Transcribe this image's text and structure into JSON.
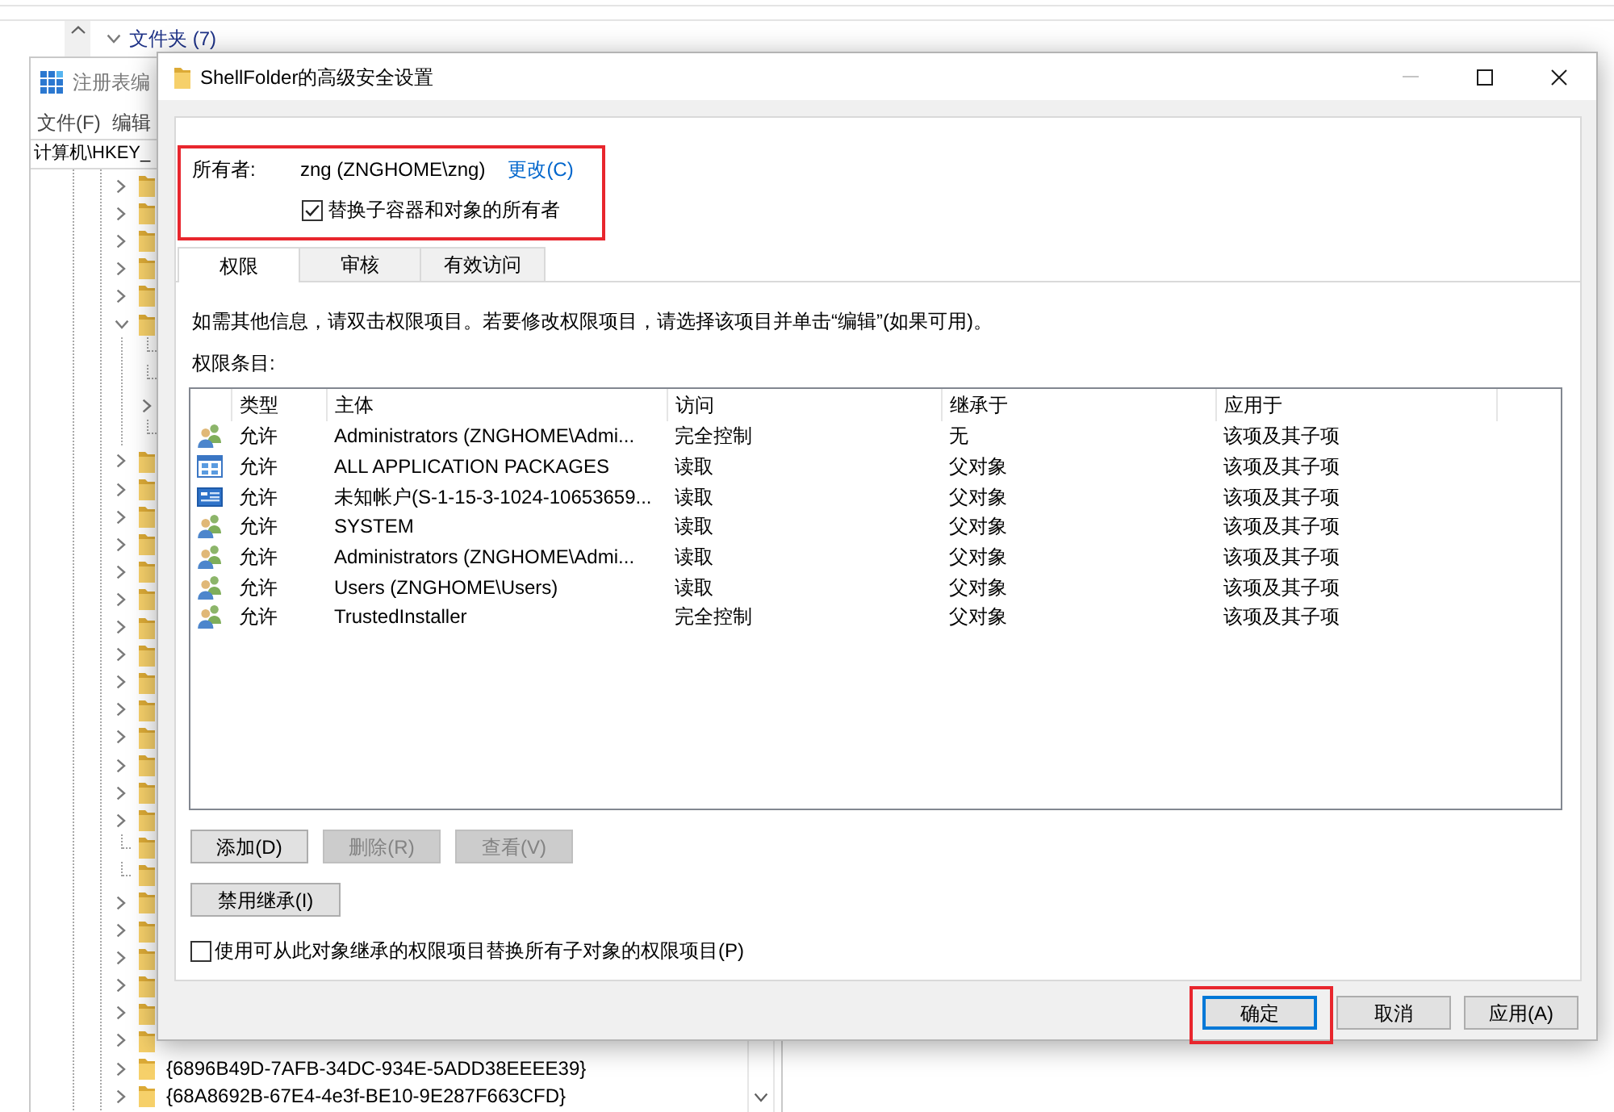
{
  "background": {
    "group_header": "文件夹 (7)"
  },
  "registry_editor": {
    "title": "注册表编",
    "menu": [
      "文件(F)",
      "编辑"
    ],
    "address": "计算机\\HKEY_",
    "tree": [
      {
        "kind": "branch",
        "expanded": false
      },
      {
        "kind": "branch",
        "expanded": false
      },
      {
        "kind": "branch",
        "expanded": false
      },
      {
        "kind": "branch",
        "expanded": false
      },
      {
        "kind": "branch",
        "expanded": false
      },
      {
        "kind": "branch",
        "expanded": true,
        "children": [
          {
            "kind": "leaf"
          },
          {
            "kind": "leaf"
          },
          {
            "kind": "branch",
            "expanded": false
          },
          {
            "kind": "leaf"
          }
        ]
      },
      {
        "kind": "branch",
        "expanded": false
      },
      {
        "kind": "branch",
        "expanded": false
      },
      {
        "kind": "branch",
        "expanded": false
      },
      {
        "kind": "branch",
        "expanded": false
      },
      {
        "kind": "branch",
        "expanded": false
      },
      {
        "kind": "branch",
        "expanded": false
      },
      {
        "kind": "branch",
        "expanded": false
      },
      {
        "kind": "branch",
        "expanded": false
      },
      {
        "kind": "branch",
        "expanded": false
      },
      {
        "kind": "branch",
        "expanded": false
      },
      {
        "kind": "branch",
        "expanded": false
      },
      {
        "kind": "branch",
        "expanded": false
      },
      {
        "kind": "branch",
        "expanded": false
      },
      {
        "kind": "branch",
        "expanded": false
      },
      {
        "kind": "leaf"
      },
      {
        "kind": "leaf"
      },
      {
        "kind": "branch",
        "expanded": false
      },
      {
        "kind": "branch",
        "expanded": false
      },
      {
        "kind": "branch",
        "expanded": false
      },
      {
        "kind": "branch",
        "expanded": false
      },
      {
        "kind": "branch",
        "expanded": false
      },
      {
        "kind": "branch",
        "expanded": false
      },
      {
        "kind": "branch",
        "expanded": false,
        "label": "{6896B49D-7AFB-34DC-934E-5ADD38EEEE39}"
      },
      {
        "kind": "branch",
        "expanded": false,
        "label": "{68A8692B-67E4-4e3f-BE10-9E287F663CFD}"
      }
    ]
  },
  "dialog": {
    "title": "ShellFolder的高级安全设置",
    "window_controls": [
      {
        "kind": "minimize",
        "disabled": true
      },
      {
        "kind": "maximize",
        "disabled": false
      },
      {
        "kind": "close",
        "disabled": false
      }
    ],
    "owner": {
      "label": "所有者:",
      "value": "zng (ZNGHOME\\zng)",
      "link": "更改(C)",
      "highlighted": true,
      "replace_option": {
        "label": "替换子容器和对象的所有者",
        "checked": true
      }
    },
    "tabs": [
      {
        "label": "权限",
        "selected": true
      },
      {
        "label": "审核",
        "selected": false
      },
      {
        "label": "有效访问",
        "selected": false
      }
    ],
    "info_text": "如需其他信息，请双击权限项目。若要修改权限项目，请选择该项目并单击“编辑”(如果可用)。",
    "entries_label": "权限条目:",
    "table": {
      "columns": [
        "类型",
        "主体",
        "访问",
        "继承于",
        "应用于"
      ],
      "rows": [
        {
          "kind": "group",
          "cells": [
            "允许",
            "Administrators (ZNGHOME\\Admi...",
            "完全控制",
            "无",
            "该项及其子项"
          ]
        },
        {
          "kind": "package",
          "cells": [
            "允许",
            "ALL APPLICATION PACKAGES",
            "读取",
            "父对象",
            "该项及其子项"
          ]
        },
        {
          "kind": "account",
          "cells": [
            "允许",
            "未知帐户(S-1-15-3-1024-10653659...",
            "读取",
            "父对象",
            "该项及其子项"
          ]
        },
        {
          "kind": "group",
          "cells": [
            "允许",
            "SYSTEM",
            "读取",
            "父对象",
            "该项及其子项"
          ]
        },
        {
          "kind": "group",
          "cells": [
            "允许",
            "Administrators (ZNGHOME\\Admi...",
            "读取",
            "父对象",
            "该项及其子项"
          ]
        },
        {
          "kind": "group",
          "cells": [
            "允许",
            "Users (ZNGHOME\\Users)",
            "读取",
            "父对象",
            "该项及其子项"
          ]
        },
        {
          "kind": "group",
          "cells": [
            "允许",
            "TrustedInstaller",
            "完全控制",
            "父对象",
            "该项及其子项"
          ]
        }
      ]
    },
    "entry_buttons": [
      {
        "label": "添加(D)",
        "disabled": false
      },
      {
        "label": "删除(R)",
        "disabled": true
      },
      {
        "label": "查看(V)",
        "disabled": true
      }
    ],
    "inheritance_button": "禁用继承(I)",
    "replace_children": {
      "label": "使用可从此对象继承的权限项目替换所有子对象的权限项目(P)",
      "checked": false
    },
    "footer_buttons": [
      {
        "label": "确定",
        "default": true,
        "highlighted": true
      },
      {
        "label": "取消",
        "default": false,
        "highlighted": false
      },
      {
        "label": "应用(A)",
        "default": false,
        "highlighted": false
      }
    ]
  }
}
